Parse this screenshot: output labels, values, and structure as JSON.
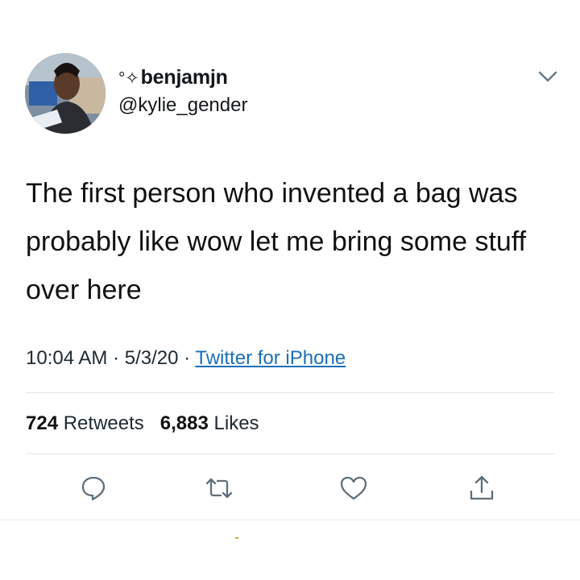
{
  "author": {
    "name_prefix": "°✧",
    "name": "benjamjn",
    "handle": "@kylie_gender"
  },
  "tweet": {
    "text": "The first person who invented a bag was probably like wow let me bring some stuff over here",
    "time": "10:04 AM",
    "date": "5/3/20",
    "source": "Twitter for iPhone",
    "separator": "·"
  },
  "stats": {
    "retweets_count": "724",
    "retweets_label": "Retweets",
    "likes_count": "6,883",
    "likes_label": "Likes"
  },
  "icons": {
    "menu": "chevron-down-icon",
    "reply": "reply-icon",
    "retweet": "retweet-icon",
    "like": "heart-icon",
    "share": "share-icon"
  },
  "colors": {
    "link": "#1b6fb5",
    "text": "#14171a",
    "icon": "#5f6e7a"
  }
}
